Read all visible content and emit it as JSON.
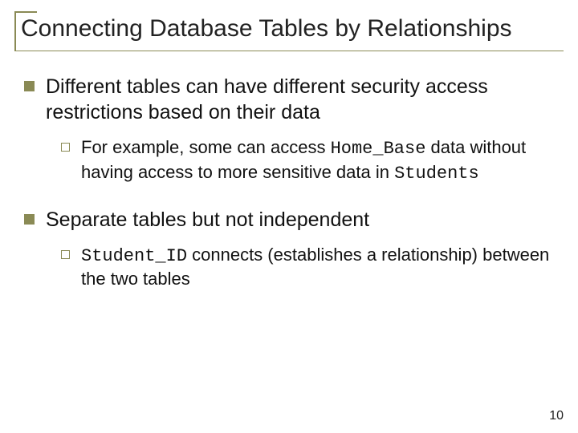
{
  "title": "Connecting Database Tables by Relationships",
  "bullets": [
    {
      "text": "Different tables can have different security access restrictions based on their data",
      "sub": [
        {
          "pre": "For example, some can access ",
          "code1": "Home_Base",
          "mid": " data without having access to more sensitive data in ",
          "code2": "Students"
        }
      ]
    },
    {
      "text": "Separate tables but not independent",
      "sub": [
        {
          "code1": "Student_ID",
          "mid": " connects (establishes a relationship) between the two tables"
        }
      ]
    }
  ],
  "pagenum": "10"
}
